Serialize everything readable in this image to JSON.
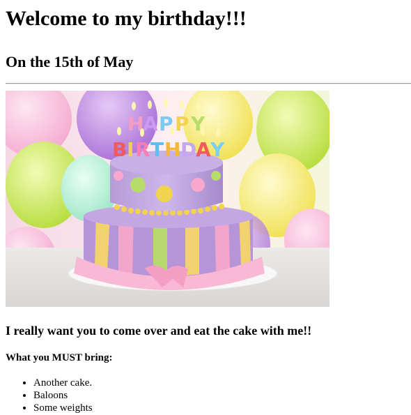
{
  "page": {
    "title": "Welcome to my birthday!!!",
    "date_line": "On the 15th of May",
    "invite_text": "I really want you to come over and eat the cake with me!!",
    "bring_heading": "What you MUST bring:",
    "bring_items": [
      "Another cake.",
      "Baloons",
      "Some weights"
    ]
  },
  "image": {
    "name": "birthday-cake-image",
    "cake_topper_text": [
      "HAPPY",
      "BIRTHDAY"
    ]
  },
  "colors": {
    "text": "#000000",
    "background": "#ffffff",
    "divider": "#999999"
  }
}
